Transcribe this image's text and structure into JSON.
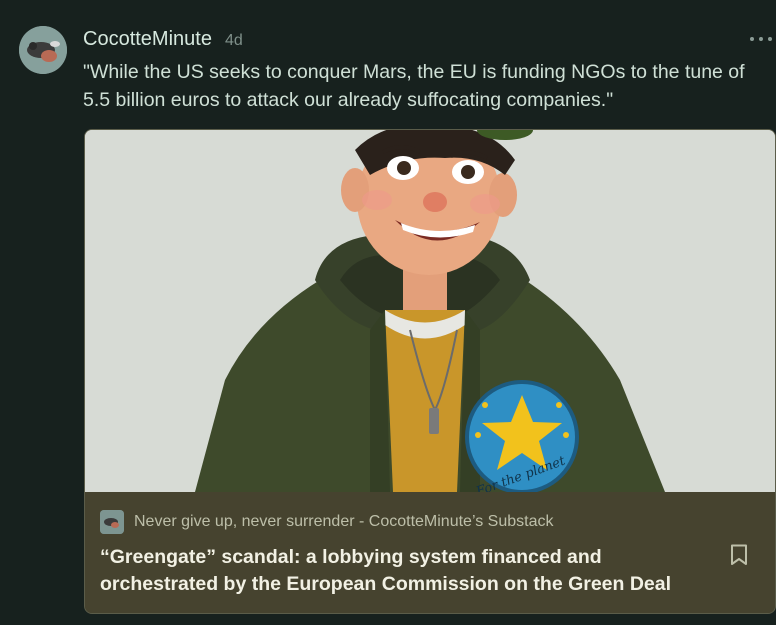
{
  "note": {
    "author": "CocotteMinute",
    "time_ago": "4d",
    "text": "\"While the US seeks to conquer Mars, the EU is funding NGOs to the tune of 5.5 billion euros to attack our already suffocating companies.\"",
    "more_icon": "more-horizontal-icon",
    "avatar_icon": "author-avatar"
  },
  "card": {
    "publication": "Never give up, never surrender - CocotteMinute’s Substack",
    "title": "“Greengate” scandal: a lobbying system financed and orchestrated by the European Commission on the Green Deal",
    "bookmark_icon": "bookmark-icon",
    "image": {
      "description_icon": "cartoon-illustration",
      "badge_text": "For the planet"
    }
  },
  "colors": {
    "background": "#17211e",
    "card_footer": "#46432f",
    "author": "#d6e8de",
    "text": "#cfe0d6",
    "hoodie": "#3f4a2a",
    "badge": "#2f8fc4",
    "star": "#f2c21c"
  }
}
